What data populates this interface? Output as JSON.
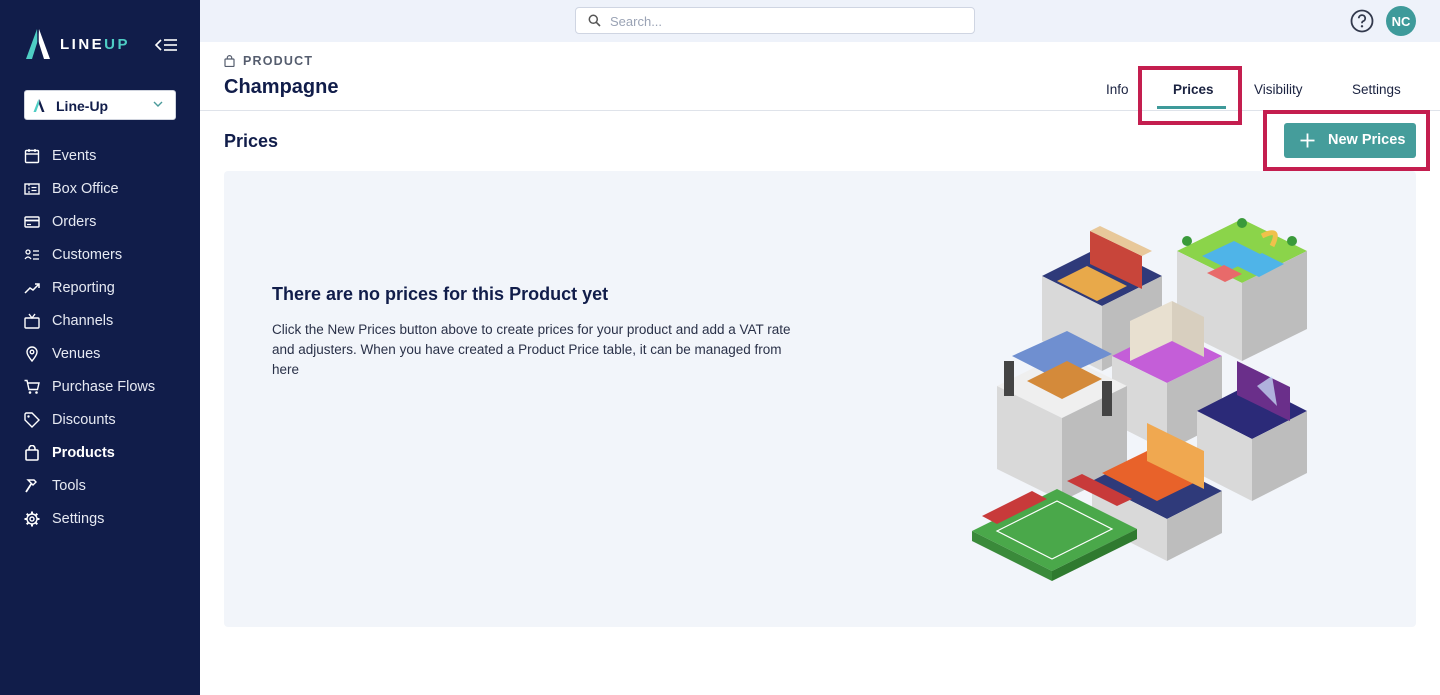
{
  "brand": {
    "name_a": "LINE",
    "name_b": "UP",
    "accent": "#4ecdc4"
  },
  "org_selector": {
    "value": "Line-Up"
  },
  "sidebar": {
    "items": [
      {
        "label": "Events",
        "icon": "calendar-icon"
      },
      {
        "label": "Box Office",
        "icon": "ticket-icon"
      },
      {
        "label": "Orders",
        "icon": "credit-card-icon"
      },
      {
        "label": "Customers",
        "icon": "customers-list-icon"
      },
      {
        "label": "Reporting",
        "icon": "trend-chart-icon"
      },
      {
        "label": "Channels",
        "icon": "tv-icon"
      },
      {
        "label": "Venues",
        "icon": "map-pin-icon"
      },
      {
        "label": "Purchase Flows",
        "icon": "cart-icon"
      },
      {
        "label": "Discounts",
        "icon": "tag-icon"
      },
      {
        "label": "Products",
        "icon": "bag-icon",
        "active": true
      },
      {
        "label": "Tools",
        "icon": "hammer-icon"
      },
      {
        "label": "Settings",
        "icon": "gear-icon"
      }
    ]
  },
  "topbar": {
    "search_placeholder": "Search...",
    "avatar_initials": "NC"
  },
  "header": {
    "breadcrumb": "PRODUCT",
    "title": "Champagne",
    "tabs": [
      {
        "label": "Info"
      },
      {
        "label": "Prices",
        "active": true
      },
      {
        "label": "Visibility"
      },
      {
        "label": "Settings"
      }
    ]
  },
  "main": {
    "section_title": "Prices",
    "new_button_label": "New Prices",
    "empty_state": {
      "title": "There are no prices for this Product yet",
      "text": "Click the New Prices button above to create prices for your product and add a VAT rate and adjusters. When you have created a Product Price table, it can be managed from here"
    }
  },
  "colors": {
    "sidebar_bg": "#111d4a",
    "accent": "#459d9b",
    "highlight": "#c41e4f"
  }
}
